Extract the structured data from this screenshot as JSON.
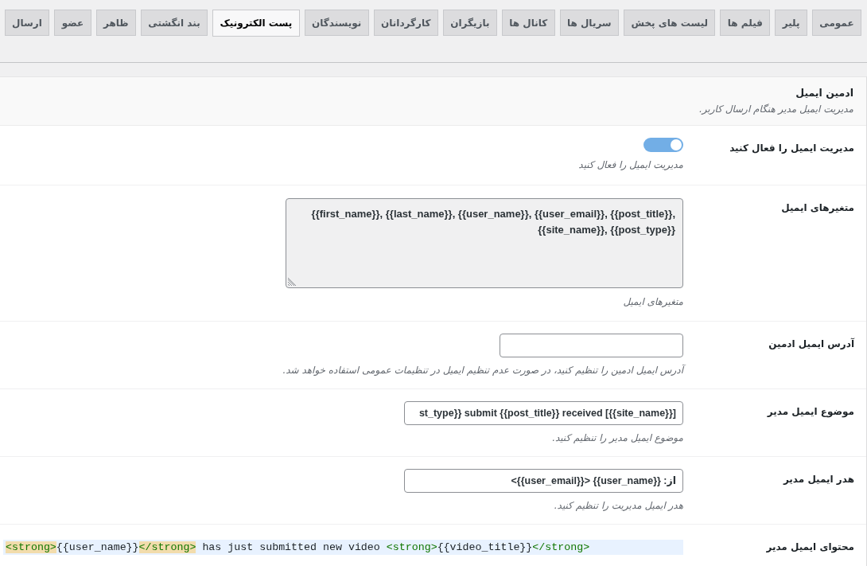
{
  "tabs": [
    {
      "label": "عمومی",
      "selected": false
    },
    {
      "label": "پلیر",
      "selected": false
    },
    {
      "label": "فیلم ها",
      "selected": false
    },
    {
      "label": "لیست های پخش",
      "selected": false
    },
    {
      "label": "سریال ها",
      "selected": false
    },
    {
      "label": "کانال ها",
      "selected": false
    },
    {
      "label": "بازیگران",
      "selected": false
    },
    {
      "label": "کارگردانان",
      "selected": false
    },
    {
      "label": "نویسندگان",
      "selected": false
    },
    {
      "label": "پست الکترونیک",
      "selected": true
    },
    {
      "label": "بند انگشتی",
      "selected": false
    },
    {
      "label": "ظاهر",
      "selected": false
    },
    {
      "label": "عضو",
      "selected": false
    },
    {
      "label": "ارسال",
      "selected": false
    }
  ],
  "section": {
    "title": "ادمین ایمیل",
    "description": "مدیریت ایمیل مدیر هنگام ارسال کاربر."
  },
  "settings": [
    {
      "kind": "toggle",
      "label": "مدیریت ایمیل را فعال کنید",
      "on": true,
      "description": "مدیریت ایمیل را فعال کنید"
    },
    {
      "kind": "textarea",
      "label": "متغیرهای ایمیل",
      "readonly": true,
      "value": "{{first_name}}, {{last_name}}, {{user_name}}, {{user_email}}, {{post_title}}, {{site_name}}, {{post_type}}",
      "description": "متغیرهای ایمیل"
    },
    {
      "kind": "email",
      "label": "آدرس ایمیل ادمین",
      "description": "آدرس ایمیل ادمین را تنظیم کنید، در صورت عدم تنظیم ایمیل در تنظیمات عمومی استفاده خواهد شد."
    },
    {
      "kind": "text",
      "label": "موضوع ایمیل مدیر",
      "value": "st_type}} submit {{post_title}} received [{{site_name}}]",
      "description": "موضوع ایمیل مدیر را تنظیم کنید."
    },
    {
      "kind": "text",
      "label": "هدر ایمیل مدیر",
      "value": "از: {{user_name}} <{{user_email}}>",
      "description": "هدر ایمیل مدیریت را تنظیم کنید."
    },
    {
      "kind": "code",
      "label": "محتوای ایمیل مدیر",
      "lines": [
        {
          "active": true,
          "tag_match": true,
          "text": "<strong>{{user_name}}</strong> has just submitted new video <strong>{{video_title}}</strong>"
        }
      ]
    }
  ]
}
